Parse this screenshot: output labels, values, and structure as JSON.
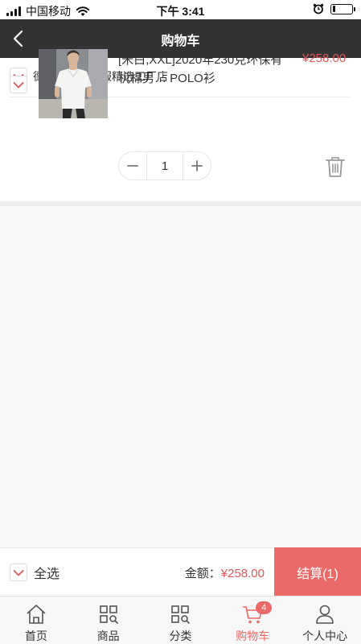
{
  "status_bar": {
    "carrier": "中国移动",
    "time": "下午 3:41",
    "battery_level": 0.15
  },
  "navbar": {
    "title": "购物车",
    "back_icon": "chevron-left-icon"
  },
  "cart": {
    "store": {
      "name": "德鲁斯内衣鞋服精选工厂店",
      "checked": true
    },
    "items": [
      {
        "title": "[米白,XXL]2020年230克环保有机棉男… POLO衫",
        "price": "¥258.00",
        "quantity": "1",
        "checked": true
      }
    ]
  },
  "bottom_bar": {
    "select_all_label": "全选",
    "total_label": "金额：",
    "total_value": "¥258.00",
    "checkout_label": "结算(1)"
  },
  "tabbar": {
    "tabs": [
      {
        "label": "首页",
        "icon": "home-icon",
        "active": false
      },
      {
        "label": "商品",
        "icon": "grid-icon",
        "active": false
      },
      {
        "label": "分类",
        "icon": "category-search-icon",
        "active": false
      },
      {
        "label": "购物车",
        "icon": "cart-icon",
        "active": true,
        "badge": "4"
      },
      {
        "label": "个人中心",
        "icon": "user-icon",
        "active": false
      }
    ]
  },
  "colors": {
    "accent": "#e96a67",
    "price": "#e0575a",
    "navbar": "#333333"
  }
}
